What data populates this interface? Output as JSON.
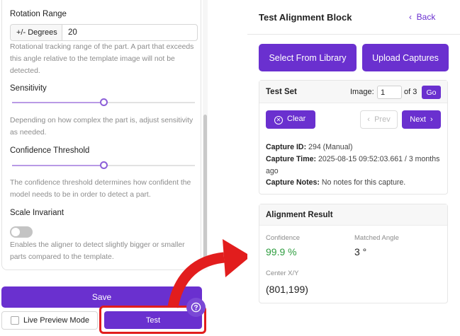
{
  "settings": {
    "rotation": {
      "label": "Rotation Range",
      "unit": "+/- Degrees",
      "value": "20",
      "help": "Rotational tracking range of the part. A part that exceeds this angle relative to the template image will not be detected."
    },
    "sensitivity": {
      "label": "Sensitivity",
      "level": 0.5,
      "help": "Depending on how complex the part is, adjust sensitivity as needed."
    },
    "confidence": {
      "label": "Confidence Threshold",
      "level": 0.5,
      "help": "The confidence threshold determines how confident the model needs to be in order to detect a part."
    },
    "scale": {
      "label": "Scale Invariant",
      "enabled": false,
      "help": "Enables the aligner to detect slightly bigger or smaller parts compared to the template."
    }
  },
  "actions": {
    "save_label": "Save",
    "live_preview_label": "Live Preview Mode",
    "test_label": "Test",
    "help_icon": "question-circle-icon"
  },
  "panel": {
    "title": "Test Alignment Block",
    "back_label": "Back",
    "library_label": "Select From Library",
    "upload_label": "Upload Captures"
  },
  "test_set": {
    "title": "Test Set",
    "image_label": "Image:",
    "image_value": "1",
    "of_label": "of 3",
    "go_label": "Go",
    "clear_label": "Clear",
    "prev_label": "Prev",
    "next_label": "Next",
    "capture_id_label": "Capture ID:",
    "capture_id_value": "294 (Manual)",
    "capture_time_label": "Capture Time:",
    "capture_time_value": "2025-08-15 09:52:03.661 / 3 months ago",
    "capture_notes_label": "Capture Notes:",
    "capture_notes_value": "No notes for this capture."
  },
  "alignment": {
    "title": "Alignment Result",
    "confidence_label": "Confidence",
    "confidence_value": "99.9 %",
    "angle_label": "Matched Angle",
    "angle_value": "3 °",
    "center_label": "Center X/Y",
    "center_value": "(801,199)"
  },
  "colors": {
    "primary": "#6a30cf",
    "success": "#2e9d3f",
    "highlight": "#e21d1d"
  }
}
